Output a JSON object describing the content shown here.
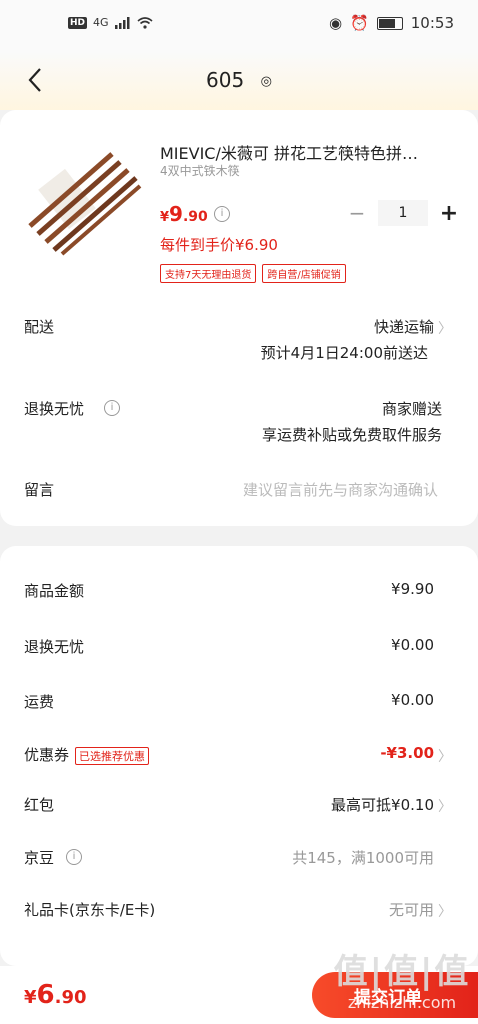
{
  "status_bar": {
    "left_icons": [
      "HD",
      "4G"
    ],
    "time": "10:53"
  },
  "nav": {
    "title": "605"
  },
  "product": {
    "title": "MIEVIC/米薇可 拼花工艺筷特色拼…",
    "subtitle": "4双中式铁木筷",
    "price_currency": "¥",
    "price_int": "9",
    "price_dec": ".90",
    "quantity": "1",
    "minus": "−",
    "plus": "+",
    "each_price": "每件到手价¥6.90",
    "tags": [
      "支持7天无理由退货",
      "跨自营/店铺促销"
    ]
  },
  "delivery": {
    "label": "配送",
    "method": "快递运输",
    "eta": "预计4月1日24:00前送达"
  },
  "return_guarantee": {
    "label": "退换无忧",
    "line1": "商家赠送",
    "line2": "享运费补贴或免费取件服务"
  },
  "message": {
    "label": "留言",
    "placeholder": "建议留言前先与商家沟通确认"
  },
  "summary": {
    "goods_label": "商品金额",
    "goods_value": "¥9.90",
    "return_label": "退换无忧",
    "return_value": "¥0.00",
    "shipping_label": "运费",
    "shipping_value": "¥0.00",
    "coupon_label": "优惠券",
    "coupon_badge": "已选推荐优惠",
    "coupon_value": "-¥3.00",
    "redpacket_label": "红包",
    "redpacket_value": "最高可抵¥0.10",
    "jingdou_label": "京豆",
    "jingdou_value": "共145，满1000可用",
    "giftcard_label": "礼品卡(京东卡/E卡)",
    "giftcard_value": "无可用"
  },
  "bottom": {
    "currency": "¥",
    "total_int": "6",
    "total_dec": ".90",
    "submit_label": "提交订单"
  },
  "watermark": {
    "big": "值|值|值",
    "small": "zhizhizhi.com"
  },
  "colors": {
    "accent_red": "#e2231a",
    "background": "#f2f2f2"
  }
}
